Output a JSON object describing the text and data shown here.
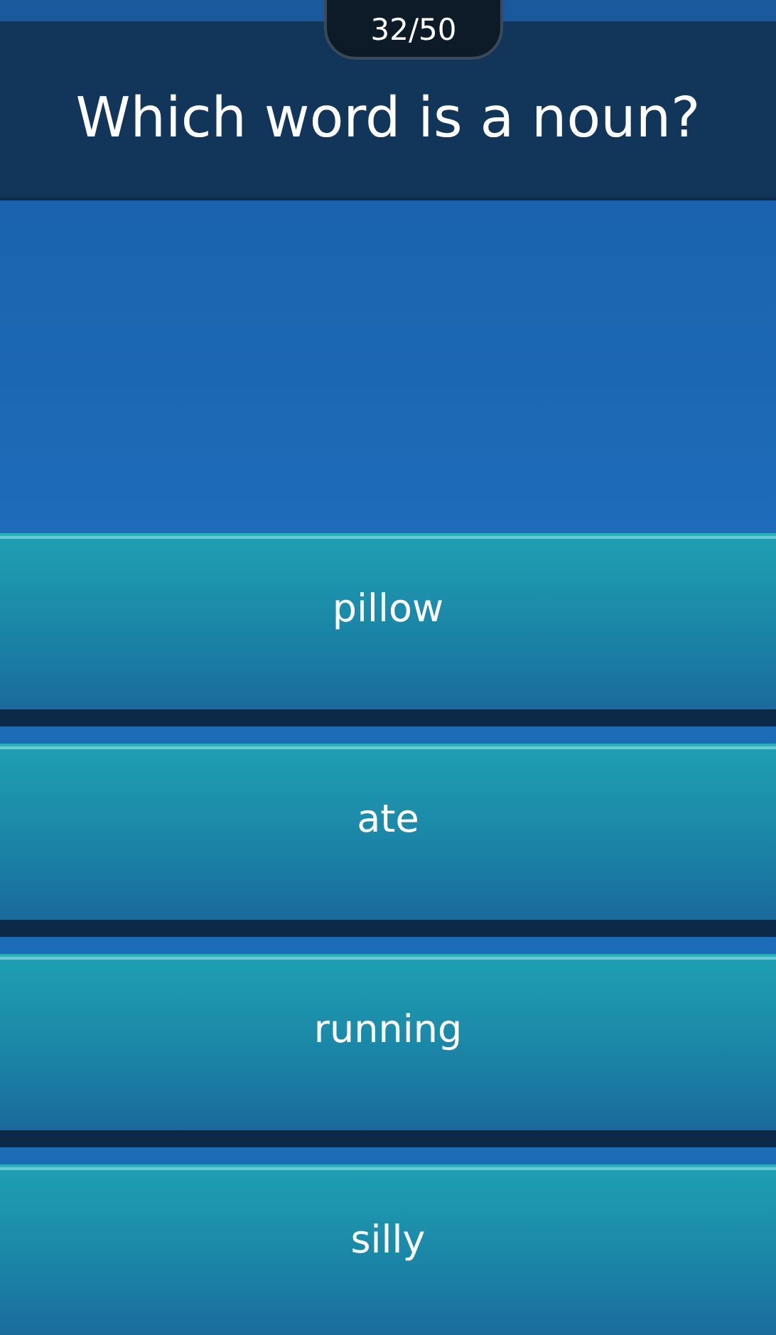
{
  "counter": "32/50",
  "question": "Which word is a noun?",
  "answers": [
    {
      "label": "pillow"
    },
    {
      "label": "ate"
    },
    {
      "label": "running"
    },
    {
      "label": "silly"
    }
  ]
}
